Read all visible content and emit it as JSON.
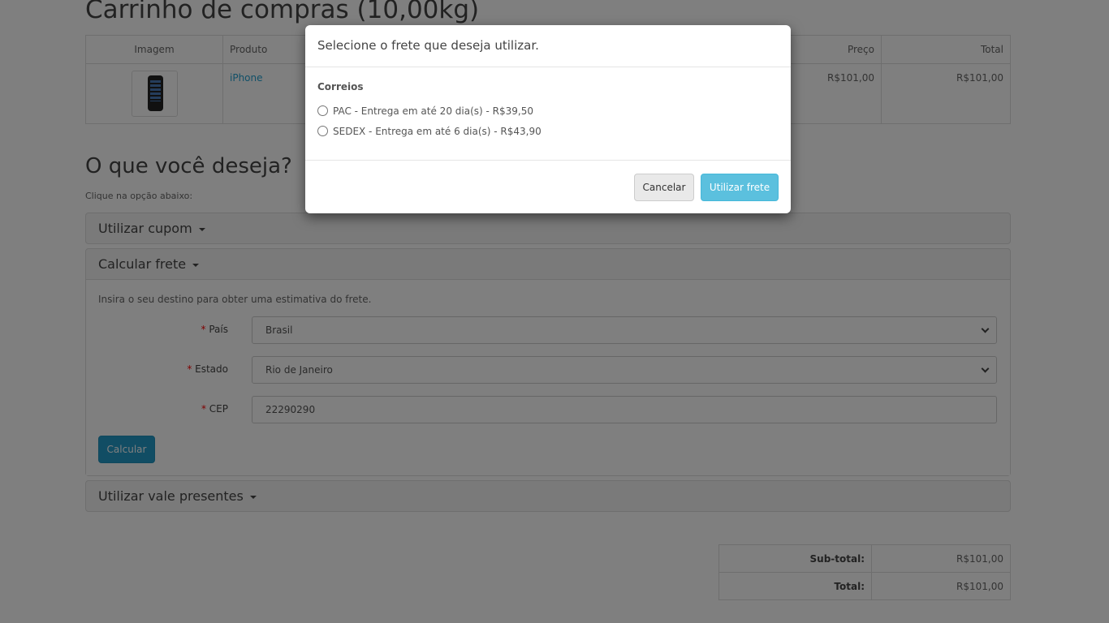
{
  "cart": {
    "title": "Carrinho de compras  (10,00kg)",
    "columns": {
      "image": "Imagem",
      "product": "Produto",
      "price": "Preço",
      "total": "Total"
    },
    "items": [
      {
        "product": "iPhone",
        "price": "R$101,00",
        "total": "R$101,00",
        "image_icon": "iphone-thumbnail"
      }
    ]
  },
  "options": {
    "heading": "O que você deseja?",
    "hint": "Clique na opção abaixo:",
    "coupon": "Utilizar cupom",
    "shipping": "Calcular frete",
    "voucher": "Utilizar vale presentes"
  },
  "shipping_form": {
    "intro": "Insira o seu destino para obter uma estimativa do frete.",
    "required_mark": "*",
    "country_label": "País",
    "country_value": "Brasil",
    "state_label": "Estado",
    "state_value": "Rio de Janeiro",
    "zip_label": "CEP",
    "zip_value": "22290290",
    "calc_button": "Calcular"
  },
  "totals": [
    {
      "label": "Sub-total:",
      "value": "R$101,00"
    },
    {
      "label": "Total:",
      "value": "R$101,00"
    }
  ],
  "modal": {
    "title": "Selecione o frete que deseja utilizar.",
    "group": "Correios",
    "options": [
      "PAC - Entrega em até 20 dia(s) - R$39,50",
      "SEDEX - Entrega em até 6 dia(s) - R$43,90"
    ],
    "cancel": "Cancelar",
    "confirm": "Utilizar frete"
  },
  "colors": {
    "link": "#23a1d1",
    "primary_button": "#229ac8",
    "info_button": "#5bc0de",
    "required": "#ff0000"
  }
}
